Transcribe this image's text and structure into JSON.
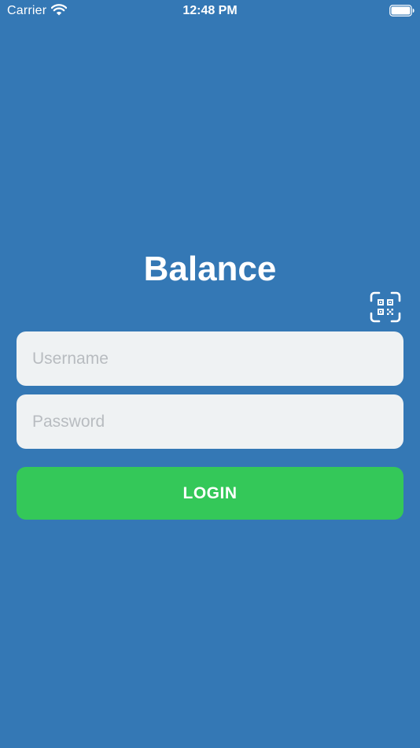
{
  "status_bar": {
    "carrier": "Carrier",
    "time": "12:48 PM"
  },
  "app": {
    "title": "Balance"
  },
  "login_form": {
    "username_placeholder": "Username",
    "password_placeholder": "Password",
    "login_label": "LOGIN"
  },
  "icons": {
    "wifi": "wifi-icon",
    "battery": "battery-icon",
    "qr_scan": "qr-scan-icon"
  },
  "colors": {
    "background": "#3478b5",
    "field_background": "#eff2f3",
    "login_button": "#34c859",
    "text_on_dark": "#ffffff"
  }
}
